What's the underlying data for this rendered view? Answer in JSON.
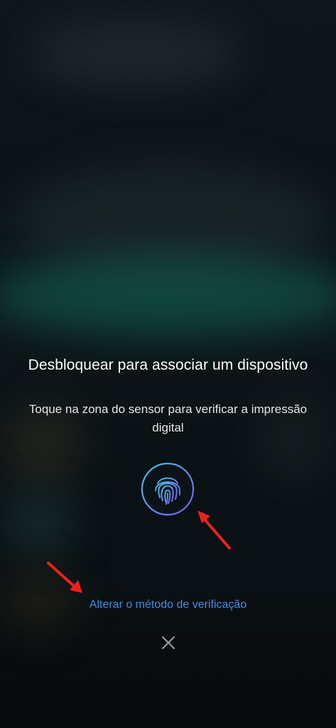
{
  "dialog": {
    "title": "Desbloquear para associar um dispositivo",
    "instruction": "Toque na zona do sensor para verificar a impressão digital",
    "alt_method_label": "Alterar o método de verificação"
  },
  "icons": {
    "fingerprint": "fingerprint-icon",
    "close": "close-icon",
    "annotation": "red-arrow-icon"
  },
  "colors": {
    "link": "#3d8fe8",
    "annotation_arrow": "#e8231c",
    "fingerprint_gradient_start": "#3fc6e8",
    "fingerprint_gradient_end": "#7b5cf0"
  }
}
